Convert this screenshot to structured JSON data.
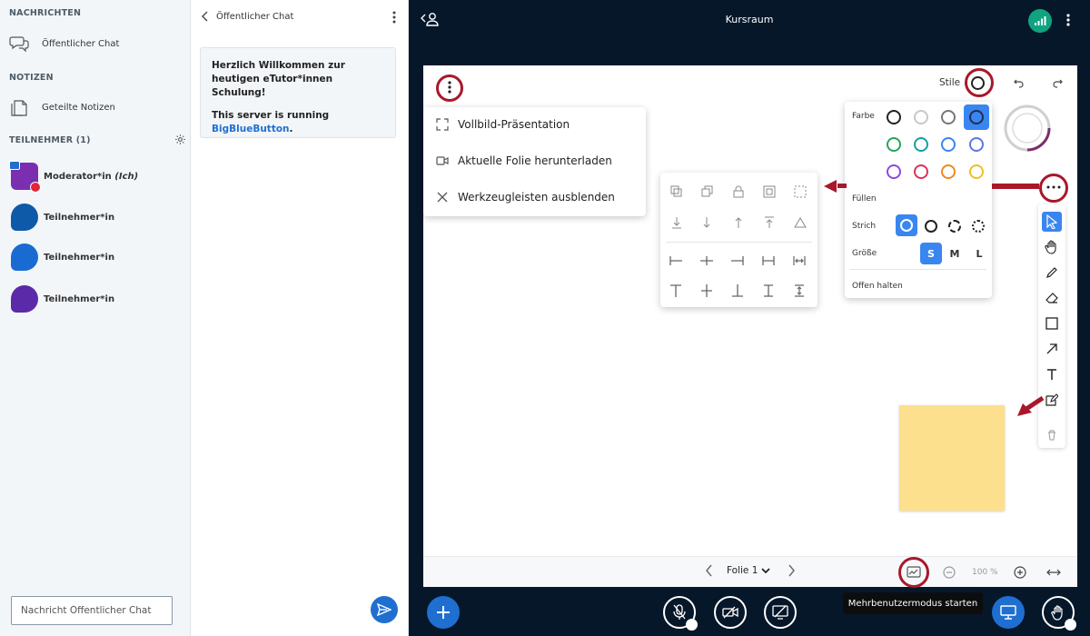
{
  "sidebar": {
    "messages_heading": "NACHRICHTEN",
    "public_chat": "Öffentlicher Chat",
    "notes_heading": "NOTIZEN",
    "shared_notes": "Geteilte Notizen",
    "participants_heading": "TEILNEHMER (1)",
    "users": [
      {
        "name": "Moderator*in",
        "suffix": "(Ich)",
        "color": "#7b2eb0"
      },
      {
        "name": "Teilnehmer*in",
        "color": "#0f5aa8"
      },
      {
        "name": "Teilnehmer*in",
        "color": "#1a6bd1"
      },
      {
        "name": "Teilnehmer*in",
        "color": "#5b2aa8"
      }
    ]
  },
  "chat": {
    "title": "Öffentlicher Chat",
    "welcome_line1": "Herzlich Willkommen zur heutigen eTutor*innen Schulung!",
    "welcome_line2": "This server is running",
    "welcome_link": "BigBlueButton",
    "welcome_period": ".",
    "input_placeholder": "Nachricht Öffentlicher Chat"
  },
  "topbar": {
    "room_title": "Kursraum"
  },
  "options_menu": {
    "items": [
      "Vollbild-Präsentation",
      "Aktuelle Folie herunterladen",
      "Werkzeugleisten ausblenden"
    ]
  },
  "styles": {
    "label": "Stile",
    "fill_label": "Farbe",
    "filling_label": "Füllen",
    "stroke_label": "Strich",
    "size_label": "Größe",
    "sizes": [
      "S",
      "M",
      "L"
    ],
    "keep_open": "Offen halten",
    "colors": [
      "#222222",
      "#bbbbbb",
      "#666666",
      "#2b3e7a",
      "#22a55b",
      "#14a0a0",
      "#3a86f0",
      "#5a78e0",
      "#8a4ae0",
      "#e0305a",
      "#f08a20",
      "#f0c020"
    ]
  },
  "footer": {
    "slide_label": "Folie 1",
    "zoom": "100 %"
  },
  "tooltip": {
    "text": "Mehrbenutzermodus starten"
  },
  "accent": "#1f6fd1",
  "highlight": "#a8182a"
}
